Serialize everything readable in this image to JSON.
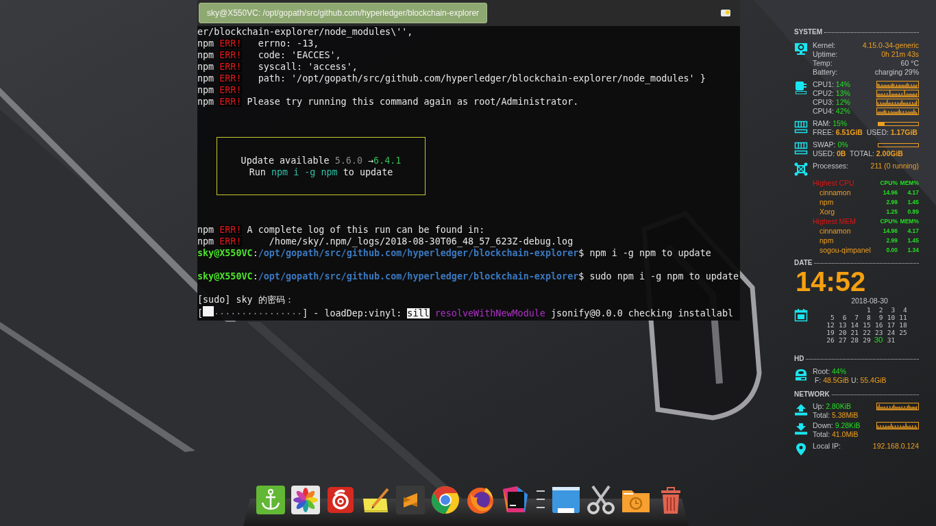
{
  "terminal": {
    "title": "sky@X550VC: /opt/gopath/src/github.com/hyperledger/blockchain-explorer",
    "lines": [
      {
        "kind": "text",
        "segments": [
          {
            "kind": "plain",
            "text": "er/blockchain-explorer/node_modules\\'',"
          }
        ]
      },
      {
        "kind": "text",
        "segments": [
          {
            "kind": "plain",
            "text": "npm "
          },
          {
            "kind": "err",
            "text": "ERR!"
          },
          {
            "kind": "plain",
            "text": "   errno: -13,"
          }
        ]
      },
      {
        "kind": "text",
        "segments": [
          {
            "kind": "plain",
            "text": "npm "
          },
          {
            "kind": "err",
            "text": "ERR!"
          },
          {
            "kind": "plain",
            "text": "   code: 'EACCES',"
          }
        ]
      },
      {
        "kind": "text",
        "segments": [
          {
            "kind": "plain",
            "text": "npm "
          },
          {
            "kind": "err",
            "text": "ERR!"
          },
          {
            "kind": "plain",
            "text": "   syscall: 'access',"
          }
        ]
      },
      {
        "kind": "text",
        "segments": [
          {
            "kind": "plain",
            "text": "npm "
          },
          {
            "kind": "err",
            "text": "ERR!"
          },
          {
            "kind": "plain",
            "text": "   path: '/opt/gopath/src/github.com/hyperledger/blockchain-explorer/node_modules' }"
          }
        ]
      },
      {
        "kind": "text",
        "segments": [
          {
            "kind": "plain",
            "text": "npm "
          },
          {
            "kind": "err",
            "text": "ERR!"
          }
        ]
      },
      {
        "kind": "text",
        "segments": [
          {
            "kind": "plain",
            "text": "npm "
          },
          {
            "kind": "err",
            "text": "ERR!"
          },
          {
            "kind": "plain",
            "text": " Please try running this command again as root/Administrator."
          }
        ]
      },
      {
        "kind": "notice",
        "lines": [
          {
            "segments": [
              {
                "kind": "plain",
                "text": "Update available "
              },
              {
                "kind": "dim",
                "text": "5.6.0"
              },
              {
                "kind": "plain",
                "text": " →"
              },
              {
                "kind": "green",
                "text": "6.4.1"
              }
            ]
          },
          {
            "segments": [
              {
                "kind": "plain",
                "text": "Run "
              },
              {
                "kind": "teal",
                "text": "npm i -g npm"
              },
              {
                "kind": "plain",
                "text": " to update"
              }
            ]
          }
        ]
      },
      {
        "kind": "text",
        "segments": [
          {
            "kind": "plain",
            "text": "npm "
          },
          {
            "kind": "err",
            "text": "ERR!"
          },
          {
            "kind": "plain",
            "text": " A complete log of this run can be found in:"
          }
        ]
      },
      {
        "kind": "text",
        "segments": [
          {
            "kind": "plain",
            "text": "npm "
          },
          {
            "kind": "err",
            "text": "ERR!"
          },
          {
            "kind": "plain",
            "text": "     /home/sky/.npm/_logs/2018-08-30T06_48_57_623Z-debug.log"
          }
        ]
      },
      {
        "kind": "text",
        "segments": [
          {
            "kind": "user",
            "text": "sky@X550VC"
          },
          {
            "kind": "plain",
            "text": ":"
          },
          {
            "kind": "path",
            "text": "/opt/gopath/src/github.com/hyperledger/blockchain-explorer"
          },
          {
            "kind": "plain",
            "text": "$ npm i -g npm to update"
          }
        ]
      },
      {
        "kind": "blank"
      },
      {
        "kind": "text",
        "segments": [
          {
            "kind": "user",
            "text": "sky@X550VC"
          },
          {
            "kind": "plain",
            "text": ":"
          },
          {
            "kind": "path",
            "text": "/opt/gopath/src/github.com/hyperledger/blockchain-explorer"
          },
          {
            "kind": "plain",
            "text": "$ sudo npm i -g npm to update"
          }
        ]
      },
      {
        "kind": "blank"
      },
      {
        "kind": "text",
        "segments": [
          {
            "kind": "plain",
            "text": "[sudo] sky 的密码："
          }
        ]
      },
      {
        "kind": "text",
        "segments": [
          {
            "kind": "plain",
            "text": "["
          },
          {
            "kind": "progress",
            "level": 0.11,
            "text": "................"
          },
          {
            "kind": "plain",
            "text": "] - loadDep:vinyl: "
          },
          {
            "kind": "inverse",
            "text": "sill"
          },
          {
            "kind": "magenta",
            "text": " resolveWithNewModule"
          },
          {
            "kind": "plain",
            "text": " jsonify@0.0.0 checking installabl"
          }
        ]
      }
    ]
  },
  "system": {
    "heading": "SYSTEM",
    "info": [
      {
        "label": "Kernel:",
        "value": "4.15.0-34-generic",
        "kind": "accent"
      },
      {
        "label": "Uptime:",
        "value": "0h 21m 43s",
        "kind": "accent"
      },
      {
        "label": "Temp:",
        "value": "60 °C",
        "kind": "plain"
      },
      {
        "label": "Battery:",
        "value": "charging 29%",
        "kind": "plain"
      }
    ],
    "cpus": [
      {
        "label": "CPU1:",
        "value": "14%"
      },
      {
        "label": "CPU2:",
        "value": "13%"
      },
      {
        "label": "CPU3:",
        "value": "12%"
      },
      {
        "label": "CPU4:",
        "value": "42%"
      }
    ],
    "memory": [
      {
        "label": "RAM:",
        "value": "15%",
        "level": 0.15,
        "a_label": "FREE:",
        "a_value": "6.51GiB",
        "b_label": "USED:",
        "b_value": "1.17GiB"
      },
      {
        "label": "SWAP:",
        "value": "0%",
        "level": 0,
        "a_label": "USED:",
        "a_value": "0B",
        "b_label": "TOTAL:",
        "b_value": "2.00GiB"
      }
    ],
    "processes": {
      "label": "Processes:",
      "value": "211 (0 running)"
    },
    "top_lists": [
      {
        "title": "Highest CPU",
        "col1": "CPU%",
        "col2": "MEM%",
        "rows": [
          {
            "name": "cinnamon",
            "cpu": "14.96",
            "mem": "4.17"
          },
          {
            "name": "npm",
            "cpu": "2.99",
            "mem": "1.45"
          },
          {
            "name": "Xorg",
            "cpu": "1.25",
            "mem": "0.89"
          }
        ]
      },
      {
        "title": "Highest MEM",
        "col1": "CPU%",
        "col2": "MEM%",
        "rows": [
          {
            "name": "cinnamon",
            "cpu": "14.96",
            "mem": "4.17"
          },
          {
            "name": "npm",
            "cpu": "2.99",
            "mem": "1.45"
          },
          {
            "name": "sogou-qimpanel",
            "cpu": "0.00",
            "mem": "1.34"
          }
        ]
      }
    ]
  },
  "date": {
    "heading": "DATE",
    "time": "14:52",
    "date": "2018-08-30",
    "weeks": [
      [
        {
          "day": "1",
          "selected": false
        },
        {
          "day": "2",
          "selected": false
        },
        {
          "day": "3",
          "selected": false
        },
        {
          "day": "4",
          "selected": false
        }
      ],
      [
        {
          "day": "5",
          "selected": false
        },
        {
          "day": "6",
          "selected": false
        },
        {
          "day": "7",
          "selected": false
        },
        {
          "day": "8",
          "selected": false
        },
        {
          "day": "9",
          "selected": false
        },
        {
          "day": "10",
          "selected": false
        },
        {
          "day": "11",
          "selected": false
        }
      ],
      [
        {
          "day": "12",
          "selected": false
        },
        {
          "day": "13",
          "selected": false
        },
        {
          "day": "14",
          "selected": false
        },
        {
          "day": "15",
          "selected": false
        },
        {
          "day": "16",
          "selected": false
        },
        {
          "day": "17",
          "selected": false
        },
        {
          "day": "18",
          "selected": false
        }
      ],
      [
        {
          "day": "19",
          "selected": false
        },
        {
          "day": "20",
          "selected": false
        },
        {
          "day": "21",
          "selected": false
        },
        {
          "day": "22",
          "selected": false
        },
        {
          "day": "23",
          "selected": false
        },
        {
          "day": "24",
          "selected": false
        },
        {
          "day": "25",
          "selected": false
        }
      ],
      [
        {
          "day": "26",
          "selected": false
        },
        {
          "day": "27",
          "selected": false
        },
        {
          "day": "28",
          "selected": false
        },
        {
          "day": "29",
          "selected": false
        },
        {
          "day": "30",
          "selected": true
        },
        {
          "day": "31",
          "selected": false
        }
      ]
    ]
  },
  "hd": {
    "heading": "HD",
    "root_label": "Root:",
    "root": "44%",
    "a_label": "F:",
    "a_value": "48.5GiB",
    "b_label": "U:",
    "b_value": "55.4GiB"
  },
  "network": {
    "heading": "NETWORK",
    "links": [
      {
        "kind": "up",
        "label": "Up:",
        "rate": "2.80KiB",
        "total_label": "Total:",
        "total": "5.38MiB"
      },
      {
        "kind": "down",
        "label": "Down:",
        "rate": "9.28KiB",
        "total_label": "Total:",
        "total": "41.0MiB"
      }
    ],
    "ip_label": "Local IP:",
    "ip": "192.168.0.124"
  },
  "dock": {
    "items": [
      {
        "kind": "anchor"
      },
      {
        "kind": "pinwheel"
      },
      {
        "kind": "spiral"
      },
      {
        "kind": "notepad"
      },
      {
        "kind": "sublime"
      },
      {
        "kind": "chrome"
      },
      {
        "kind": "firefox"
      },
      {
        "kind": "ide"
      },
      {
        "kind": "windows"
      },
      {
        "kind": "window"
      },
      {
        "kind": "scissors"
      },
      {
        "kind": "folder"
      },
      {
        "kind": "trash"
      }
    ]
  }
}
